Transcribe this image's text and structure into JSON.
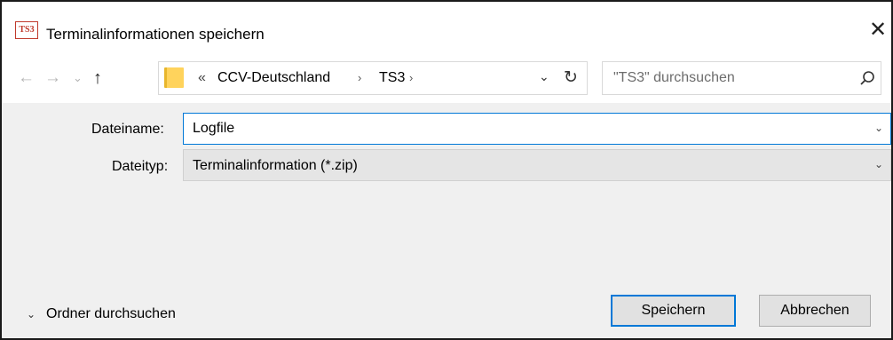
{
  "window": {
    "title": "Terminalinformationen speichern",
    "app_icon_text": "TS3",
    "close_glyph": "✕"
  },
  "nav": {
    "back_glyph": "←",
    "forward_glyph": "→",
    "recent_glyph": "⌄",
    "up_glyph": "↑",
    "breadcrumb_more": "«",
    "breadcrumbs": [
      "CCV-Deutschland",
      "TS3"
    ],
    "separator_glyph": "›",
    "dropdown_glyph": "⌄",
    "refresh_glyph": "↻"
  },
  "search": {
    "placeholder": "\"TS3\" durchsuchen"
  },
  "form": {
    "filename_label": "Dateiname:",
    "filename_value": "Logfile",
    "filetype_label": "Dateityp:",
    "filetype_value": "Terminalinformation (*.zip)",
    "combo_arrow": "⌄"
  },
  "footer": {
    "toggle_chevron": "⌄",
    "toggle_label": "Ordner durchsuchen",
    "save_label": "Speichern",
    "cancel_label": "Abbrechen"
  },
  "colors": {
    "accent": "#0078d7",
    "folder": "#ffd35c"
  }
}
